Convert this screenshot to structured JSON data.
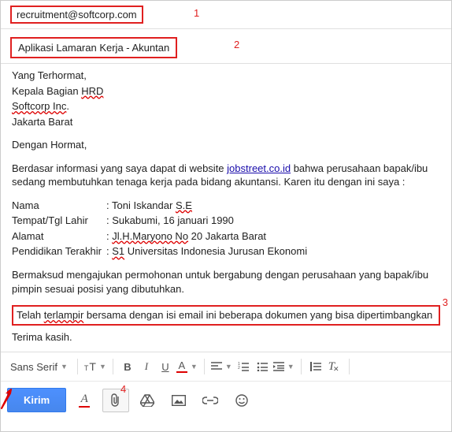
{
  "annotations": {
    "a1": "1",
    "a2": "2",
    "a3": "3",
    "a4": "4"
  },
  "to": "recruitment@softcorp.com",
  "subject": "Aplikasi Lamaran Kerja - Akuntan",
  "body": {
    "salutation_l1": "Yang Terhormat,",
    "salutation_l2a": "Kepala Bagian ",
    "salutation_l2b_red": "HRD",
    "salutation_l3_red": "Softcorp Inc",
    "salutation_l3_dot": ".",
    "salutation_l4": "Jakarta Barat",
    "greeting": "Dengan Hormat,",
    "intro_a": "Berdasar informasi yang saya dapat di website ",
    "intro_link": "jobstreet.co.id",
    "intro_b": " bahwa perusahaan bapak/ibu sedang membutuhkan tenaga kerja pada bidang akuntansi. Karen itu dengan ini saya :",
    "row1_label": "Nama",
    "row1_sep": ": ",
    "row1_val_a": "Toni Iskandar ",
    "row1_val_b_red": "S.E",
    "row2_label": "Tempat/Tgl Lahir",
    "row2_sep": ": ",
    "row2_val": "Sukabumi, 16 januari 1990",
    "row3_label": "Alamat",
    "row3_sep": ": ",
    "row3_val_a_red": "Jl.H.Maryono No",
    "row3_val_b": " 20 Jakarta Barat",
    "row4_label": "Pendidikan Terakhir",
    "row4_sep": ": ",
    "row4_val_a_red": "S1",
    "row4_val_b": " Universitas Indonesia Jurusan Ekonomi",
    "para2": "Bermaksud mengajukan permohonan untuk bergabung dengan perusahaan yang bapak/ibu pimpin sesuai posisi yang dibutuhkan.",
    "attach_a": "Telah ",
    "attach_b_red": "terlampir",
    "attach_c": " bersama dengan isi email ini beberapa dokumen yang bisa dipertimbangkan",
    "closing": "Terima kasih."
  },
  "toolbar": {
    "font_name": "Sans Serif",
    "send_label": "Kirim"
  }
}
